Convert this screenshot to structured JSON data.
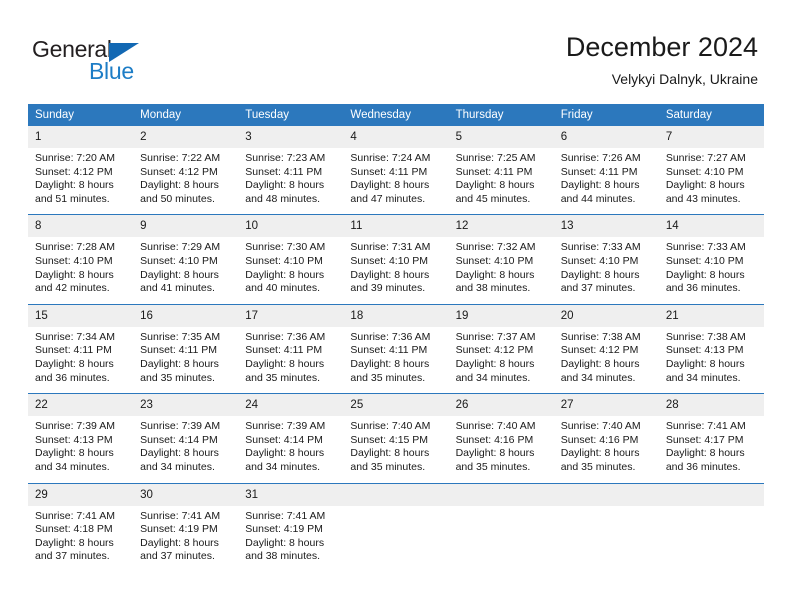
{
  "brand": {
    "name_part1": "General",
    "name_part2": "Blue",
    "triangle_color": "#1268b3",
    "blue_color": "#1d7dc6"
  },
  "header": {
    "title": "December 2024",
    "subtitle": "Velykyi Dalnyk, Ukraine"
  },
  "theme": {
    "header_bg": "#2c78bd",
    "daynum_bg": "#efefef",
    "rule_color": "#2c78bd",
    "text_color": "#1a1a1a"
  },
  "weekdays": [
    "Sunday",
    "Monday",
    "Tuesday",
    "Wednesday",
    "Thursday",
    "Friday",
    "Saturday"
  ],
  "weeks": [
    [
      {
        "day": "1",
        "sunrise": "Sunrise: 7:20 AM",
        "sunset": "Sunset: 4:12 PM",
        "daylight1": "Daylight: 8 hours",
        "daylight2": "and 51 minutes."
      },
      {
        "day": "2",
        "sunrise": "Sunrise: 7:22 AM",
        "sunset": "Sunset: 4:12 PM",
        "daylight1": "Daylight: 8 hours",
        "daylight2": "and 50 minutes."
      },
      {
        "day": "3",
        "sunrise": "Sunrise: 7:23 AM",
        "sunset": "Sunset: 4:11 PM",
        "daylight1": "Daylight: 8 hours",
        "daylight2": "and 48 minutes."
      },
      {
        "day": "4",
        "sunrise": "Sunrise: 7:24 AM",
        "sunset": "Sunset: 4:11 PM",
        "daylight1": "Daylight: 8 hours",
        "daylight2": "and 47 minutes."
      },
      {
        "day": "5",
        "sunrise": "Sunrise: 7:25 AM",
        "sunset": "Sunset: 4:11 PM",
        "daylight1": "Daylight: 8 hours",
        "daylight2": "and 45 minutes."
      },
      {
        "day": "6",
        "sunrise": "Sunrise: 7:26 AM",
        "sunset": "Sunset: 4:11 PM",
        "daylight1": "Daylight: 8 hours",
        "daylight2": "and 44 minutes."
      },
      {
        "day": "7",
        "sunrise": "Sunrise: 7:27 AM",
        "sunset": "Sunset: 4:10 PM",
        "daylight1": "Daylight: 8 hours",
        "daylight2": "and 43 minutes."
      }
    ],
    [
      {
        "day": "8",
        "sunrise": "Sunrise: 7:28 AM",
        "sunset": "Sunset: 4:10 PM",
        "daylight1": "Daylight: 8 hours",
        "daylight2": "and 42 minutes."
      },
      {
        "day": "9",
        "sunrise": "Sunrise: 7:29 AM",
        "sunset": "Sunset: 4:10 PM",
        "daylight1": "Daylight: 8 hours",
        "daylight2": "and 41 minutes."
      },
      {
        "day": "10",
        "sunrise": "Sunrise: 7:30 AM",
        "sunset": "Sunset: 4:10 PM",
        "daylight1": "Daylight: 8 hours",
        "daylight2": "and 40 minutes."
      },
      {
        "day": "11",
        "sunrise": "Sunrise: 7:31 AM",
        "sunset": "Sunset: 4:10 PM",
        "daylight1": "Daylight: 8 hours",
        "daylight2": "and 39 minutes."
      },
      {
        "day": "12",
        "sunrise": "Sunrise: 7:32 AM",
        "sunset": "Sunset: 4:10 PM",
        "daylight1": "Daylight: 8 hours",
        "daylight2": "and 38 minutes."
      },
      {
        "day": "13",
        "sunrise": "Sunrise: 7:33 AM",
        "sunset": "Sunset: 4:10 PM",
        "daylight1": "Daylight: 8 hours",
        "daylight2": "and 37 minutes."
      },
      {
        "day": "14",
        "sunrise": "Sunrise: 7:33 AM",
        "sunset": "Sunset: 4:10 PM",
        "daylight1": "Daylight: 8 hours",
        "daylight2": "and 36 minutes."
      }
    ],
    [
      {
        "day": "15",
        "sunrise": "Sunrise: 7:34 AM",
        "sunset": "Sunset: 4:11 PM",
        "daylight1": "Daylight: 8 hours",
        "daylight2": "and 36 minutes."
      },
      {
        "day": "16",
        "sunrise": "Sunrise: 7:35 AM",
        "sunset": "Sunset: 4:11 PM",
        "daylight1": "Daylight: 8 hours",
        "daylight2": "and 35 minutes."
      },
      {
        "day": "17",
        "sunrise": "Sunrise: 7:36 AM",
        "sunset": "Sunset: 4:11 PM",
        "daylight1": "Daylight: 8 hours",
        "daylight2": "and 35 minutes."
      },
      {
        "day": "18",
        "sunrise": "Sunrise: 7:36 AM",
        "sunset": "Sunset: 4:11 PM",
        "daylight1": "Daylight: 8 hours",
        "daylight2": "and 35 minutes."
      },
      {
        "day": "19",
        "sunrise": "Sunrise: 7:37 AM",
        "sunset": "Sunset: 4:12 PM",
        "daylight1": "Daylight: 8 hours",
        "daylight2": "and 34 minutes."
      },
      {
        "day": "20",
        "sunrise": "Sunrise: 7:38 AM",
        "sunset": "Sunset: 4:12 PM",
        "daylight1": "Daylight: 8 hours",
        "daylight2": "and 34 minutes."
      },
      {
        "day": "21",
        "sunrise": "Sunrise: 7:38 AM",
        "sunset": "Sunset: 4:13 PM",
        "daylight1": "Daylight: 8 hours",
        "daylight2": "and 34 minutes."
      }
    ],
    [
      {
        "day": "22",
        "sunrise": "Sunrise: 7:39 AM",
        "sunset": "Sunset: 4:13 PM",
        "daylight1": "Daylight: 8 hours",
        "daylight2": "and 34 minutes."
      },
      {
        "day": "23",
        "sunrise": "Sunrise: 7:39 AM",
        "sunset": "Sunset: 4:14 PM",
        "daylight1": "Daylight: 8 hours",
        "daylight2": "and 34 minutes."
      },
      {
        "day": "24",
        "sunrise": "Sunrise: 7:39 AM",
        "sunset": "Sunset: 4:14 PM",
        "daylight1": "Daylight: 8 hours",
        "daylight2": "and 34 minutes."
      },
      {
        "day": "25",
        "sunrise": "Sunrise: 7:40 AM",
        "sunset": "Sunset: 4:15 PM",
        "daylight1": "Daylight: 8 hours",
        "daylight2": "and 35 minutes."
      },
      {
        "day": "26",
        "sunrise": "Sunrise: 7:40 AM",
        "sunset": "Sunset: 4:16 PM",
        "daylight1": "Daylight: 8 hours",
        "daylight2": "and 35 minutes."
      },
      {
        "day": "27",
        "sunrise": "Sunrise: 7:40 AM",
        "sunset": "Sunset: 4:16 PM",
        "daylight1": "Daylight: 8 hours",
        "daylight2": "and 35 minutes."
      },
      {
        "day": "28",
        "sunrise": "Sunrise: 7:41 AM",
        "sunset": "Sunset: 4:17 PM",
        "daylight1": "Daylight: 8 hours",
        "daylight2": "and 36 minutes."
      }
    ],
    [
      {
        "day": "29",
        "sunrise": "Sunrise: 7:41 AM",
        "sunset": "Sunset: 4:18 PM",
        "daylight1": "Daylight: 8 hours",
        "daylight2": "and 37 minutes."
      },
      {
        "day": "30",
        "sunrise": "Sunrise: 7:41 AM",
        "sunset": "Sunset: 4:19 PM",
        "daylight1": "Daylight: 8 hours",
        "daylight2": "and 37 minutes."
      },
      {
        "day": "31",
        "sunrise": "Sunrise: 7:41 AM",
        "sunset": "Sunset: 4:19 PM",
        "daylight1": "Daylight: 8 hours",
        "daylight2": "and 38 minutes."
      },
      {
        "day": "",
        "sunrise": "",
        "sunset": "",
        "daylight1": "",
        "daylight2": ""
      },
      {
        "day": "",
        "sunrise": "",
        "sunset": "",
        "daylight1": "",
        "daylight2": ""
      },
      {
        "day": "",
        "sunrise": "",
        "sunset": "",
        "daylight1": "",
        "daylight2": ""
      },
      {
        "day": "",
        "sunrise": "",
        "sunset": "",
        "daylight1": "",
        "daylight2": ""
      }
    ]
  ]
}
